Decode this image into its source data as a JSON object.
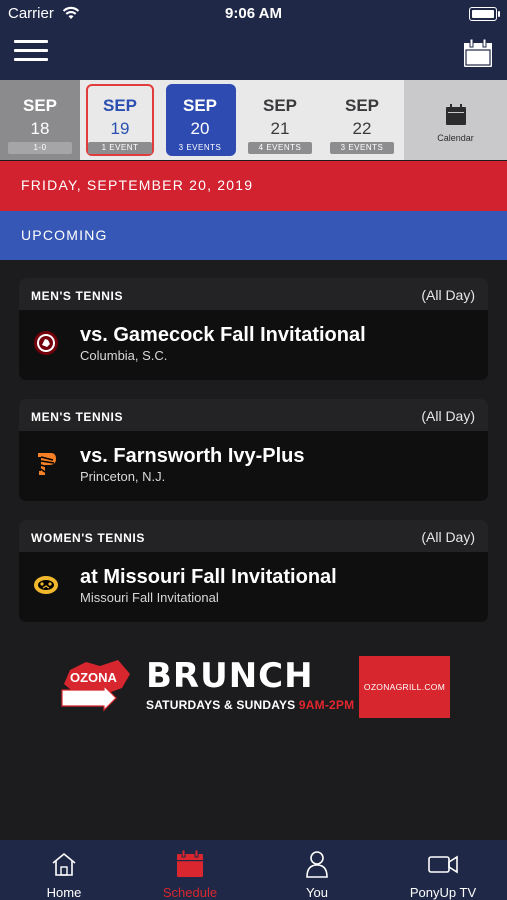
{
  "status_bar": {
    "carrier": "Carrier",
    "time": "9:06 AM"
  },
  "dates": [
    {
      "month": "SEP",
      "day": "18",
      "badge": "1-0",
      "state": "past"
    },
    {
      "month": "SEP",
      "day": "19",
      "badge": "1 EVENT",
      "state": "today"
    },
    {
      "month": "SEP",
      "day": "20",
      "badge": "3 EVENTS",
      "state": "selected"
    },
    {
      "month": "SEP",
      "day": "21",
      "badge": "4 EVENTS",
      "state": "normal"
    },
    {
      "month": "SEP",
      "day": "22",
      "badge": "3 EVENTS",
      "state": "normal"
    }
  ],
  "calendar_label": "Calendar",
  "selected_date_label": "FRIDAY, SEPTEMBER 20, 2019",
  "section_label": "UPCOMING",
  "events": [
    {
      "sport": "MEN'S TENNIS",
      "time": "(All Day)",
      "title": "vs. Gamecock Fall Invitational",
      "location": "Columbia, S.C.",
      "opponent_logo": "gamecock-logo"
    },
    {
      "sport": "MEN'S TENNIS",
      "time": "(All Day)",
      "title": "vs. Farnsworth Ivy-Plus",
      "location": "Princeton, N.J.",
      "opponent_logo": "princeton-logo"
    },
    {
      "sport": "WOMEN'S TENNIS",
      "time": "(All Day)",
      "title": "at Missouri Fall Invitational",
      "location": "Missouri Fall Invitational",
      "opponent_logo": "missouri-logo"
    }
  ],
  "ad": {
    "brand": "OZONA",
    "headline": "BRUNCH",
    "days": "SATURDAYS & SUNDAYS ",
    "hours": "9AM-2PM",
    "url": "OZONAGRILL.COM"
  },
  "tabs": [
    {
      "label": "Home",
      "icon": "home-icon",
      "active": false
    },
    {
      "label": "Schedule",
      "icon": "schedule-icon",
      "active": true
    },
    {
      "label": "You",
      "icon": "user-icon",
      "active": false
    },
    {
      "label": "PonyUp TV",
      "icon": "video-icon",
      "active": false
    }
  ],
  "colors": {
    "nav_bg": "#1f2846",
    "date_band": "#d2212f",
    "upcoming_band": "#3657b5",
    "selected_date": "#2d4bb0",
    "active_tab": "#d9262f"
  }
}
